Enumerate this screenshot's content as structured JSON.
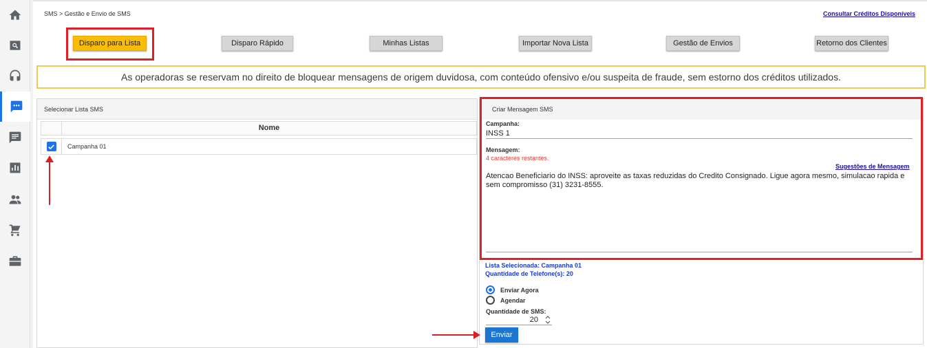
{
  "rail": {
    "items": [
      {
        "icon": "home-icon"
      },
      {
        "icon": "search-icon"
      },
      {
        "icon": "headset-icon"
      },
      {
        "icon": "chat-dots-icon",
        "active": true
      },
      {
        "icon": "message-icon"
      },
      {
        "icon": "bar-chart-icon"
      },
      {
        "icon": "people-icon"
      },
      {
        "icon": "cart-icon"
      },
      {
        "icon": "briefcase-icon"
      }
    ]
  },
  "header": {
    "breadcrumb": "SMS > Gestão e Envio de SMS",
    "credits_link": "Consultar Créditos Disponíveis"
  },
  "toolbar": {
    "buttons": [
      {
        "label": "Disparo para Lista",
        "active": true
      },
      {
        "label": "Disparo Rápido"
      },
      {
        "label": "Minhas Listas"
      },
      {
        "label": "Importar Nova Lista"
      },
      {
        "label": "Gestão de Envios"
      },
      {
        "label": "Retorno dos Clientes"
      }
    ]
  },
  "notice": "As operadoras se reservam no direito de bloquear mensagens de origem duvidosa, com conteúdo ofensivo e/ou suspeita de fraude, sem estorno dos créditos utilizados.",
  "list_panel": {
    "title": "Selecionar Lista SMS",
    "column_name": "Nome",
    "rows": [
      {
        "name": "Campanha 01",
        "checked": true
      }
    ]
  },
  "message_panel": {
    "title": "Criar Mensagem SMS",
    "campaign_label": "Campanha:",
    "campaign_value": "INSS 1",
    "message_label": "Mensagem:",
    "remaining": "4 caracteres restantes.",
    "suggestions_link": "Sugestões de Mensagem",
    "message_text": "Atencao Beneficiario do INSS: aproveite as taxas reduzidas do Credito Consignado. Ligue agora mesmo, simulacao rapida e sem compromisso (31) 3231-8555."
  },
  "send_section": {
    "selected_list": "Lista Selecionada: Campanha 01",
    "phone_count": "Quantidade de Telefone(s): 20",
    "option_now": "Enviar Agora",
    "option_schedule": "Agendar",
    "selected_option": "Enviar Agora",
    "sms_qty_label": "Quantidade de SMS:",
    "sms_qty_value": "20",
    "send_button": "Enviar"
  },
  "colors": {
    "accent": "#1a73e8",
    "primary_button": "#fbbc05",
    "highlight_border": "#e3202a",
    "notice_border": "#f2c94c",
    "link": "#1a0dab",
    "info_text": "#1a3ccf"
  }
}
